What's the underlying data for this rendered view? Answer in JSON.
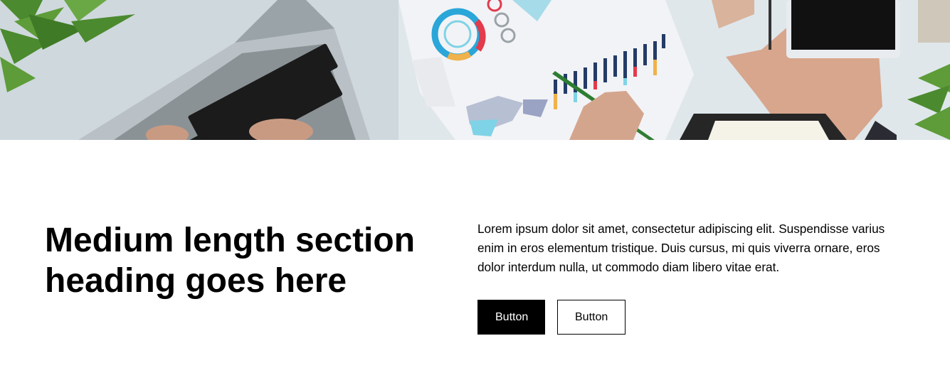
{
  "hero": {
    "image_name": "office-desk-analytics-photo"
  },
  "section": {
    "heading": "Medium length section heading goes here",
    "body": "Lorem ipsum dolor sit amet, consectetur adipiscing elit. Suspendisse varius enim in eros elementum tristique. Duis cursus, mi quis viverra ornare, eros dolor interdum nulla, ut commodo diam libero vitae erat.",
    "primary_button_label": "Button",
    "secondary_button_label": "Button"
  },
  "colors": {
    "primary_button_bg": "#000000",
    "primary_button_text": "#ffffff",
    "secondary_button_bg": "#ffffff",
    "secondary_button_border": "#000000"
  }
}
